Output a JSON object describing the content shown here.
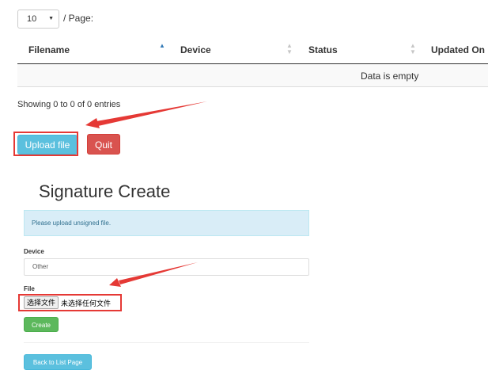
{
  "list": {
    "page_size": "10",
    "per_page_label": "/ Page:",
    "columns": [
      "Filename",
      "Device",
      "Status",
      "Updated On"
    ],
    "empty_message": "Data is empty",
    "showing_text": "Showing 0 to 0 of 0 entries"
  },
  "actions": {
    "upload_label": "Upload file",
    "quit_label": "Quit"
  },
  "create_form": {
    "title": "Signature Create",
    "alert": "Please upload unsigned file.",
    "device_label": "Device",
    "device_value": "Other",
    "file_label": "File",
    "choose_file_label": "选择文件",
    "no_file_text": "未选择任何文件",
    "create_label": "Create",
    "back_label": "Back to List Page"
  },
  "colors": {
    "info": "#5bc0de",
    "danger": "#d9534f",
    "success": "#5cb85c",
    "alert_bg": "#d9edf7",
    "annotation_red": "#e53935"
  }
}
